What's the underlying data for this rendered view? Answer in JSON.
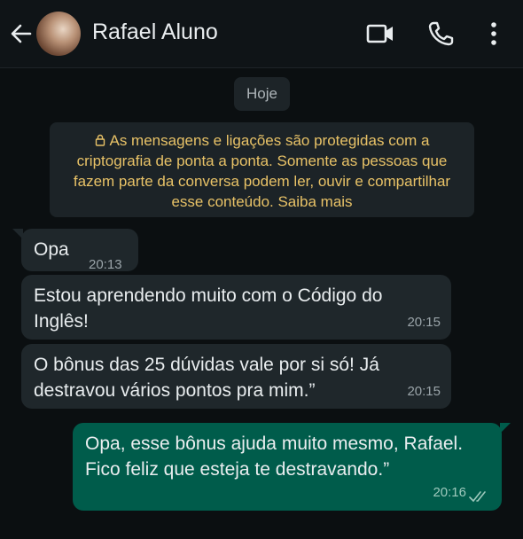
{
  "header": {
    "contact_name": "Rafael Aluno"
  },
  "chat": {
    "date_label": "Hoje",
    "encryption_notice": "As mensagens e ligações são protegidas com a criptografia de ponta a ponta. Somente as pessoas que fazem parte da conversa podem ler, ouvir e compartilhar esse conteúdo. Saiba mais",
    "messages": [
      {
        "direction": "incoming",
        "text": "Opa",
        "time": "20:13"
      },
      {
        "direction": "incoming",
        "text": "Estou aprendendo muito com o Código do Inglês!",
        "time": "20:15"
      },
      {
        "direction": "incoming",
        "text": "O bônus das 25 dúvidas vale por si só! Já destravou vários pontos pra mim.”",
        "time": "20:15"
      },
      {
        "direction": "outgoing",
        "text": "Opa, esse bônus ajuda muito mesmo, Rafael. Fico feliz que esteja te destravando.”",
        "time": "20:16",
        "status": "delivered"
      }
    ]
  },
  "icons": {
    "back": "arrow-left-icon",
    "video": "video-camera-icon",
    "call": "phone-icon",
    "menu": "more-vertical-icon",
    "lock": "lock-icon",
    "ticks": "double-check-icon"
  },
  "colors": {
    "incoming_bubble": "#1f272b",
    "outgoing_bubble": "#005c4b",
    "encryption_text": "#e8c267",
    "background": "#0b0f11"
  }
}
